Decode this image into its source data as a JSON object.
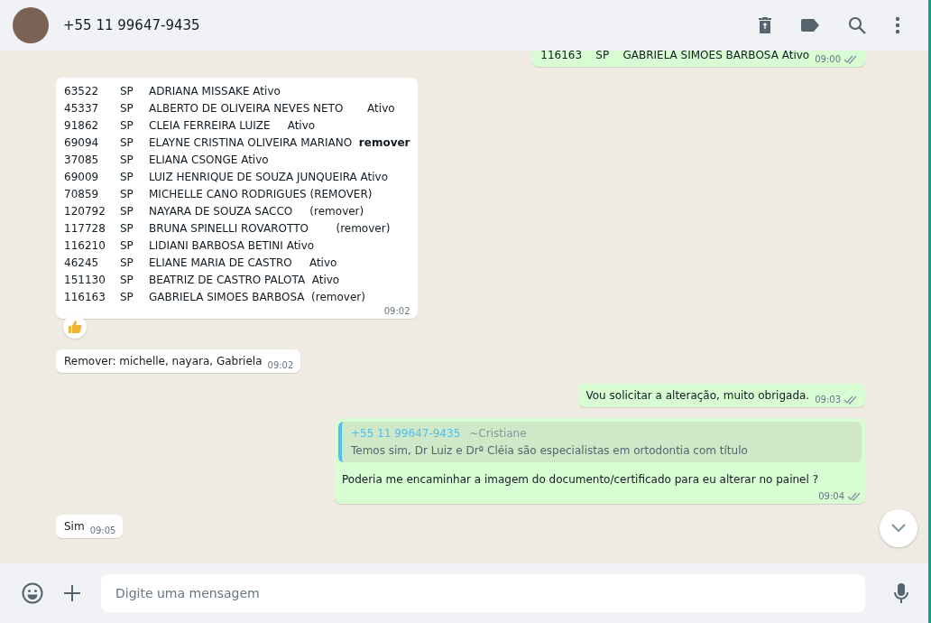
{
  "header": {
    "contact": "+55 11 99647-9435"
  },
  "messages": [
    {
      "kind": "text",
      "sent": true,
      "text": "116163    SP    GABRIELA SIMOES BARBOSA Ativo",
      "time": "09:00"
    },
    {
      "kind": "list",
      "sent": false,
      "rows": [
        {
          "code": "63522",
          "uf": "SP",
          "text": "ADRIANA MISSAKE Ativo"
        },
        {
          "code": "45337",
          "uf": "SP",
          "text": "ALBERTO DE OLIVEIRA NEVES NETO       Ativo"
        },
        {
          "code": "91862",
          "uf": "SP",
          "text": "CLEIA FERREIRA LUIZE     Ativo"
        },
        {
          "code": "69094",
          "uf": "SP",
          "text": "ELAYNE CRISTINA OLIVEIRA MARIANO  **remover**"
        },
        {
          "code": "37085",
          "uf": "SP",
          "text": "ELIANA CSONGE Ativo"
        },
        {
          "code": "69009",
          "uf": "SP",
          "text": "LUIZ HENRIQUE DE SOUZA JUNQUEIRA Ativo"
        },
        {
          "code": "70859",
          "uf": "SP",
          "text": "MICHELLE CANO RODRIGUES (REMOVER)"
        },
        {
          "code": "120792",
          "uf": "SP",
          "text": "NAYARA DE SOUZA SACCO     (remover)"
        },
        {
          "code": "117728",
          "uf": "SP",
          "text": "BRUNA SPINELLI ROVAROTTO        (remover)"
        },
        {
          "code": "116210",
          "uf": "SP",
          "text": "LIDIANI BARBOSA BETINI Ativo"
        },
        {
          "code": "46245",
          "uf": "SP",
          "text": "ELIANE MARIA DE CASTRO     Ativo"
        },
        {
          "code": "151130",
          "uf": "SP",
          "text": "BEATRIZ DE CASTRO PALOTA  Ativo"
        },
        {
          "code": "116163",
          "uf": "SP",
          "text": "GABRIELA SIMOES BARBOSA  (remover)"
        }
      ],
      "time": "09:02",
      "reaction": true
    },
    {
      "kind": "text",
      "sent": false,
      "text": "Remover: michelle, nayara, Gabriela",
      "time": "09:02"
    },
    {
      "kind": "text",
      "sent": true,
      "text": "Vou solicitar a alteração, muito obrigada.",
      "time": "09:03"
    },
    {
      "kind": "reply",
      "sent": true,
      "quote": {
        "author": "+55 11 99647-9435",
        "name": "~Cristiane",
        "text": "Temos sim, Dr Luiz e Drª Cléia são especialistas em ortodontia com título"
      },
      "text": "Poderia me encaminhar a imagem do documento/certificado para eu alterar no painel ?",
      "time": "09:04"
    },
    {
      "kind": "text",
      "sent": false,
      "text": "Sim",
      "time": "09:05"
    }
  ],
  "composer": {
    "placeholder": "Digite uma mensagem"
  }
}
